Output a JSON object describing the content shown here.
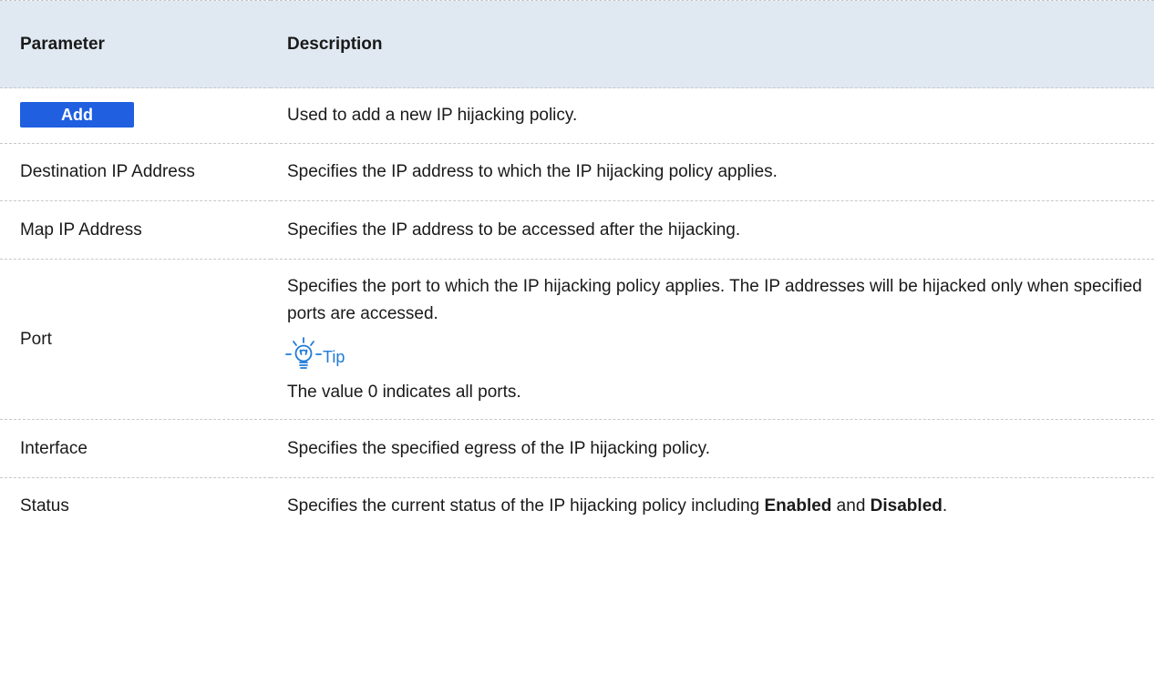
{
  "table": {
    "header": {
      "parameter": "Parameter",
      "description": "Description"
    },
    "rows": {
      "add": {
        "button_label": "Add",
        "description": "Used to add a new IP hijacking policy."
      },
      "destination_ip": {
        "name": "Destination IP Address",
        "description": "Specifies the IP address to which the IP hijacking policy applies."
      },
      "map_ip": {
        "name": "Map IP Address",
        "description": "Specifies the IP address to be accessed after the hijacking."
      },
      "port": {
        "name": "Port",
        "description": "Specifies the port to which the IP hijacking policy applies. The IP addresses will be hijacked only when specified ports are accessed.",
        "tip_label": "Tip",
        "tip_text": "The value 0 indicates all ports."
      },
      "interface": {
        "name": "Interface",
        "description": "Specifies the specified egress of the IP hijacking policy."
      },
      "status": {
        "name": "Status",
        "description_prefix": "Specifies the current status of the IP hijacking policy including ",
        "enabled": "Enabled",
        "joiner": " and ",
        "disabled": "Disabled",
        "suffix": "."
      }
    }
  },
  "colors": {
    "header_bg": "#e0e9f2",
    "add_button": "#1f5fe0",
    "tip_accent": "#1f7ad8"
  },
  "icons": {
    "tip": "lightbulb-icon"
  }
}
